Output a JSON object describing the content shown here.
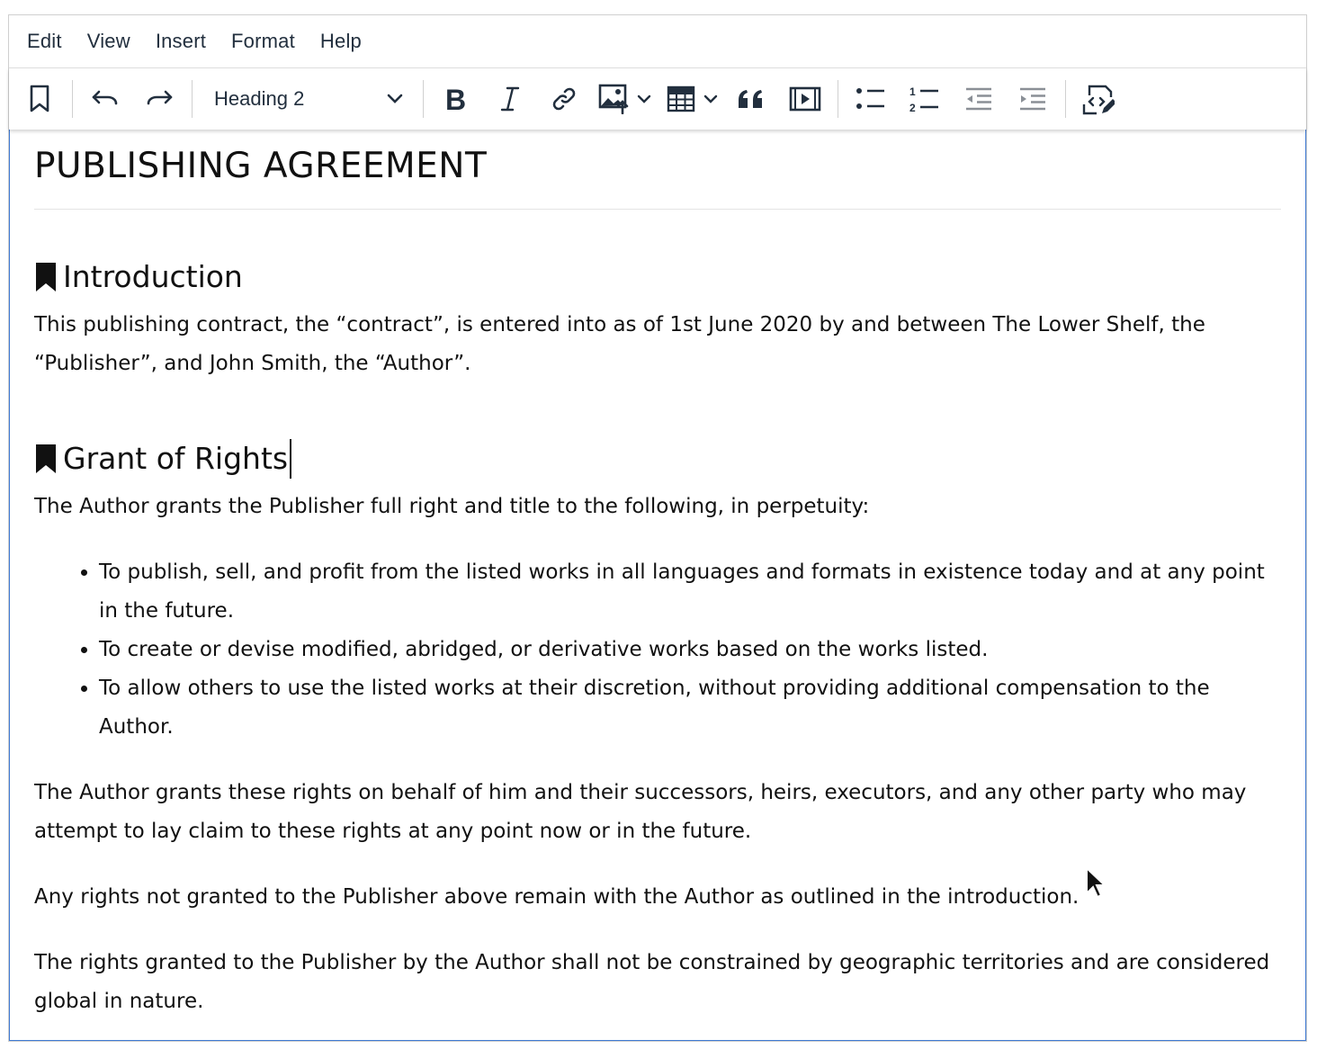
{
  "menubar": {
    "items": [
      "Edit",
      "View",
      "Insert",
      "Format",
      "Help"
    ]
  },
  "toolbar": {
    "block_format": "Heading 2",
    "icons": [
      "bookmark-icon",
      "undo-icon",
      "redo-icon",
      "bold-icon",
      "italic-icon",
      "link-icon",
      "image-icon",
      "table-icon",
      "blockquote-icon",
      "media-icon",
      "bullet-list-icon",
      "numbered-list-icon",
      "outdent-icon",
      "indent-icon",
      "source-code-icon"
    ]
  },
  "document": {
    "title": "PUBLISHING AGREEMENT",
    "sections": [
      {
        "heading": "Introduction",
        "paragraph": "This publishing contract, the “contract”, is entered into as of 1st June 2020 by and between The Lower Shelf, the “Publisher”, and John Smith, the “Author”."
      },
      {
        "heading": "Grant of Rights",
        "intro": "The Author grants the Publisher full right and title to the following, in perpetuity:",
        "bullets": [
          "To publish, sell, and profit from the listed works in all languages and formats in existence today and at any point in the future.",
          "To create or devise modified, abridged, or derivative works based on the works listed.",
          "To allow others to use the listed works at their discretion, without providing additional compensation to the Author."
        ],
        "paragraphs": [
          "The Author grants these rights on behalf of him and their successors, heirs, executors, and any other party who may attempt to lay claim to these rights at any point now or in the future.",
          "Any rights not granted to the Publisher above remain with the Author as outlined in the introduction.",
          "The rights granted to the Publisher by the Author shall not be constrained by geographic territories and are considered global in nature."
        ]
      }
    ]
  }
}
